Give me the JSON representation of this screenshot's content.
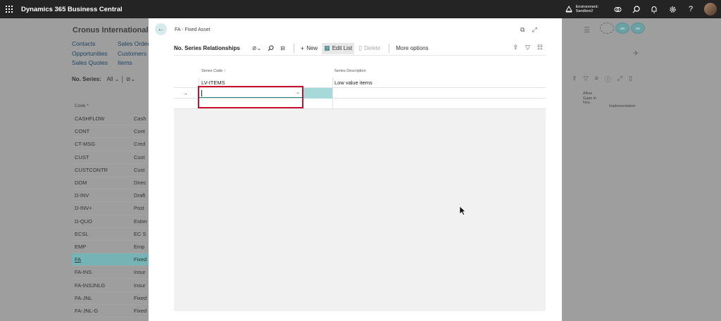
{
  "topbar": {
    "brand": "Dynamics 365 Business Central",
    "environment_label": "Environment:",
    "environment_value": "Sandbox2"
  },
  "background": {
    "company": "Cronus International",
    "links": [
      [
        "Contacts",
        "Sales Orders"
      ],
      [
        "Opportunities",
        "Customers"
      ],
      [
        "Sales Quotes",
        "Items"
      ]
    ],
    "toolbar_label": "No. Series:",
    "toolbar_filter": "All",
    "column_code": "Code *",
    "rows": [
      {
        "code": "CASHFLOW",
        "desc": "Cash"
      },
      {
        "code": "CONT",
        "desc": "Cont"
      },
      {
        "code": "CT-MSG",
        "desc": "Cred"
      },
      {
        "code": "CUST",
        "desc": "Cust"
      },
      {
        "code": "CUSTCONTR",
        "desc": "Cust"
      },
      {
        "code": "DOM",
        "desc": "Direc"
      },
      {
        "code": "D-INV",
        "desc": "Draft"
      },
      {
        "code": "D-INV+",
        "desc": "Post"
      },
      {
        "code": "D-QUO",
        "desc": "Estim"
      },
      {
        "code": "ECSL",
        "desc": "EC S"
      },
      {
        "code": "EMP",
        "desc": "Emp"
      },
      {
        "code": "FA",
        "desc": "Fixed"
      },
      {
        "code": "FA-INS",
        "desc": "Insur"
      },
      {
        "code": "FA-INSJNLG",
        "desc": "Insur"
      },
      {
        "code": "FA-JNL",
        "desc": "Fixed"
      },
      {
        "code": "FA-JNL-G",
        "desc": "Fixed"
      }
    ],
    "right_col_head": "Allow Gaps in Nos.",
    "right_col_head2": "Implementation",
    "badges": [
      "",
      "RR",
      "RR"
    ]
  },
  "modal": {
    "breadcrumb": "FA - Fixed Asset",
    "page_name": "No. Series Relationships",
    "actions": {
      "new": "New",
      "edit_list": "Edit List",
      "delete": "Delete",
      "more": "More options"
    },
    "grid": {
      "col_code": "Series Code ↑",
      "col_desc": "Series Description",
      "rows": [
        {
          "code": "LV-ITEMS",
          "desc": "Low value items"
        }
      ]
    }
  }
}
